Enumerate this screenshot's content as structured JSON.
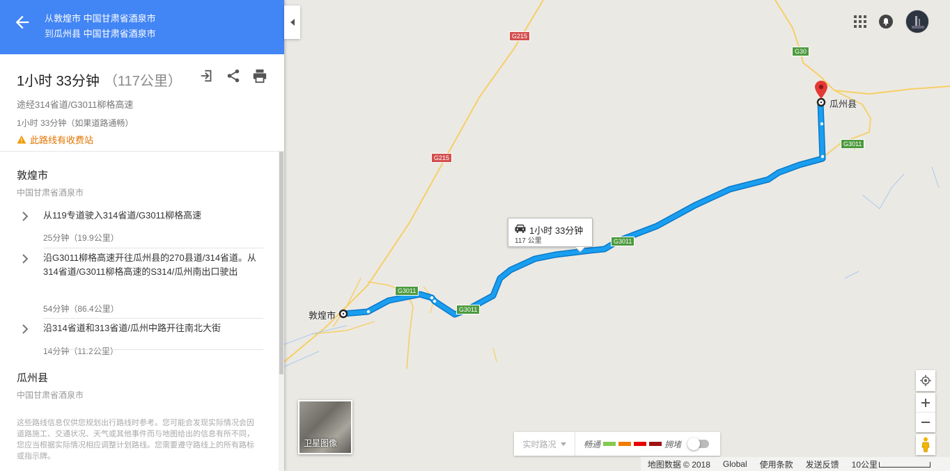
{
  "header": {
    "from_prefix": "从",
    "from_name": "敦煌市",
    "from_region": "中国甘肃省酒泉市",
    "to_prefix": "到",
    "to_name": "瓜州县",
    "to_region": "中国甘肃省酒泉市"
  },
  "summary": {
    "duration": "1小时 33分钟",
    "distance": "（117公里）",
    "via": "途经314省道/G3011柳格高速",
    "traffic_note": "1小时 33分钟（如果道路通畅）",
    "toll_warning": "此路线有收费站"
  },
  "origin": {
    "name": "敦煌市",
    "region": "中国甘肃省酒泉市"
  },
  "steps": [
    {
      "text": "从119专道驶入314省道/G3011柳格高速",
      "meta": "25分钟（19.9公里）"
    },
    {
      "text": "沿G3011柳格高速开往瓜州县的270县道/314省道。从314省道/G3011柳格高速的S314/瓜州南出口驶出",
      "meta": "54分钟（86.4公里）"
    },
    {
      "text": "沿314省道和313省道/瓜州中路开往南北大街",
      "meta": "14分钟（11.2公里）"
    }
  ],
  "destination": {
    "name": "瓜州县",
    "region": "中国甘肃省酒泉市"
  },
  "disclaimer": "这些路线信息仅供您规划出行路线时参考。您可能会发现实际情况会因道路施工、交通状况、天气或其他事件而与地图给出的信息有所不同，您应当根据实际情况相应调整计划路线。您需要遵守路线上的所有路标或指示牌。",
  "map": {
    "labels": {
      "origin": "敦煌市",
      "destination": "瓜州县"
    },
    "shields": [
      "G215",
      "G215",
      "G30",
      "G3011",
      "G3011",
      "G3011",
      "G3011"
    ],
    "bubble": {
      "duration": "1小时 33分钟",
      "distance": "117 公里"
    },
    "satellite_label": "卫星图像",
    "traffic": {
      "dropdown": "实时路况",
      "smooth": "畅通",
      "congested": "拥堵",
      "colors": [
        "#84ca50",
        "#f07d02",
        "#e60000",
        "#9e1313"
      ]
    },
    "footer": {
      "data": "地图数据 © 2018",
      "region": "Global",
      "terms": "使用条款",
      "feedback": "发送反馈",
      "scale": "10公里"
    },
    "colors": {
      "route": "#1a9ff0",
      "route_border": "#0a78c8",
      "road": "#f6cf65",
      "shield": "#d34f4f",
      "shield_expressway": "#4c9a3d",
      "accent": "#4285f4",
      "pin": "#e53935"
    }
  },
  "icons": {
    "back": "arrow-left-icon",
    "expand": "expand-icon",
    "share": "share-icon",
    "print": "print-icon",
    "toll": "warning-icon",
    "apps": "apps-grid-icon",
    "notifications": "bell-icon",
    "my_location": "my-location-icon",
    "zoom_in": "plus-icon",
    "zoom_out": "minus-icon",
    "pegman": "pegman-icon"
  }
}
